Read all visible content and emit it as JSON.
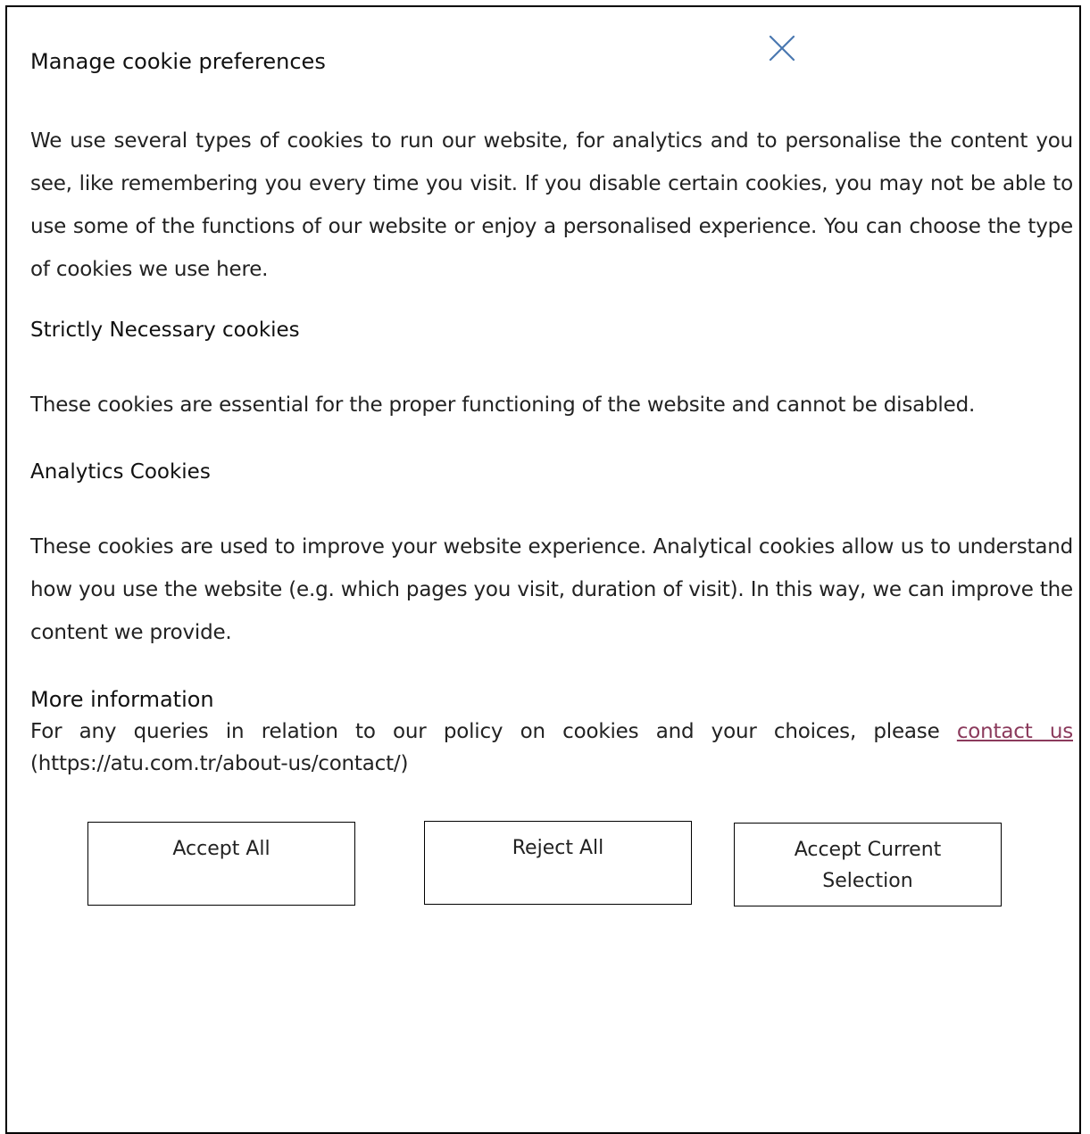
{
  "dialog": {
    "title": "Manage cookie preferences",
    "close_icon": "close-icon",
    "intro": "We use several types of cookies to run our website, for analytics and to personalise the content you see, like remembering you every time you visit. If you disable certain cookies, you may not be able to use some of the functions of our website or enjoy a personalised experience. You can choose the type of cookies we use here."
  },
  "sections": {
    "necessary": {
      "heading": "Strictly Necessary cookies",
      "text": "These cookies are essential for the proper functioning of the website and cannot be disabled."
    },
    "analytics": {
      "heading": "Analytics Cookies",
      "text": "These cookies are used to improve your website experience. Analytical cookies allow us to understand how you use the website (e.g. which pages you visit, duration of visit). In this way, we can improve the content we provide."
    }
  },
  "more_info": {
    "heading": "More information",
    "text_before": "For any queries in relation to our policy on cookies and your choices, please ",
    "link_label": "contact us",
    "text_after": " (https://atu.com.tr/about-us/contact/)"
  },
  "buttons": {
    "accept_all": "Accept All",
    "reject_all": "Reject All",
    "accept_current": "Accept Current Selection"
  },
  "colors": {
    "link": "#8b3a5c",
    "close_icon": "#4a78b0",
    "border": "#000000"
  }
}
